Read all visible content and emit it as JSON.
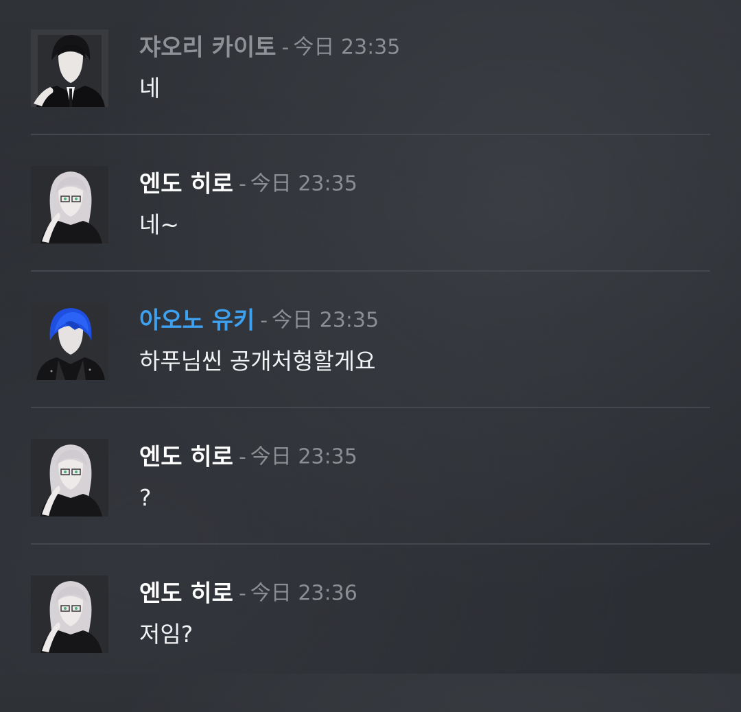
{
  "messages": [
    {
      "author": "쟈오리 카이토",
      "author_color": "#8e9297",
      "separator": "-",
      "timestamp": "今日 23:35",
      "text": "네",
      "avatar": "dark-hair-suit-avatar"
    },
    {
      "author": "엔도 히로",
      "author_color": "#ffffff",
      "separator": "-",
      "timestamp": "今日 23:35",
      "text": "네~",
      "avatar": "white-hair-glasses-avatar"
    },
    {
      "author": "아오노 유키",
      "author_color": "#3ea1f0",
      "separator": "-",
      "timestamp": "今日 23:35",
      "text": "하푸님씬 공개처형할게요",
      "avatar": "blue-hair-avatar"
    },
    {
      "author": "엔도 히로",
      "author_color": "#ffffff",
      "separator": "-",
      "timestamp": "今日 23:35",
      "text": "?",
      "avatar": "white-hair-glasses-avatar"
    },
    {
      "author": "엔도 히로",
      "author_color": "#ffffff",
      "separator": "-",
      "timestamp": "今日 23:36",
      "text": "저임?",
      "avatar": "white-hair-glasses-avatar"
    }
  ]
}
